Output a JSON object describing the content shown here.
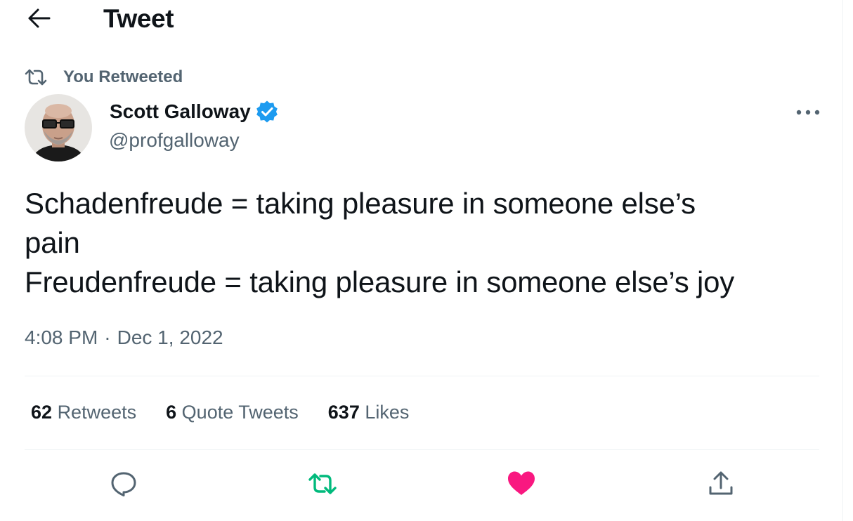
{
  "header": {
    "title": "Tweet",
    "back_icon": "arrow-left-icon"
  },
  "context": {
    "label": "You Retweeted",
    "icon": "retweet-icon"
  },
  "author": {
    "name": "Scott Galloway",
    "handle": "@profgalloway",
    "verified_icon": "verified-badge-icon"
  },
  "tweet": {
    "lines": [
      "Schadenfreude = taking pleasure in someone else’s",
      "pain",
      "Freudenfreude = taking pleasure in someone else’s joy"
    ],
    "time": "4:08 PM",
    "separator": "·",
    "date": "Dec 1, 2022"
  },
  "stats": {
    "retweets": {
      "count": "62",
      "label": "Retweets"
    },
    "quotes": {
      "count": "6",
      "label": "Quote Tweets"
    },
    "likes": {
      "count": "637",
      "label": "Likes"
    }
  },
  "actions": [
    "reply-icon",
    "retweet-icon",
    "like-icon",
    "share-icon"
  ],
  "colors": {
    "text_primary": "#0f1419",
    "text_secondary": "#536471",
    "verified_blue": "#1d9bf0",
    "retweeted_green": "#00ba7c",
    "liked_pink": "#f91880",
    "divider": "#eff3f4"
  }
}
